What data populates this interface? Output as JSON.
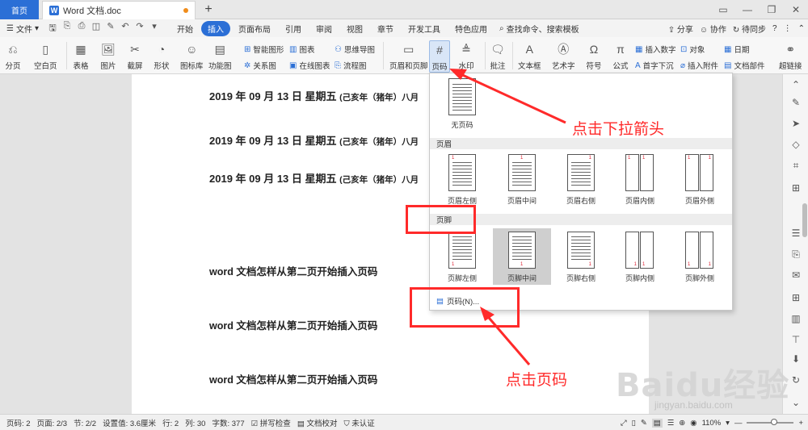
{
  "tabbar": {
    "home": "首页",
    "doc_tab": "Word 文档.doc",
    "new_tab": "+",
    "win_icons": [
      "▭",
      "—",
      "❐",
      "✕"
    ]
  },
  "menubar": {
    "file": "文件",
    "tabs": [
      "开始",
      "插入",
      "页面布局",
      "引用",
      "审阅",
      "视图",
      "章节",
      "开发工具",
      "特色应用"
    ],
    "active_tab": "插入",
    "search": "查找命令、搜索模板",
    "share": "分享",
    "cloud": "协作",
    "pending": "待同步",
    "help": "?"
  },
  "ribbon": {
    "page_break": "分页",
    "blank_page": "空白页",
    "table": "表格",
    "picture": "图片",
    "screenshot": "截屏",
    "shape": "形状",
    "icon_lib": "图标库",
    "func_chart": "功能图",
    "smart_art": "智能图形",
    "chart": "图表",
    "mind_map": "思维导图",
    "relation": "关系图",
    "online_chart": "在线图表",
    "flow_chart": "流程图",
    "header_footer": "页眉和页脚",
    "page_number": "页码",
    "watermark": "水印",
    "comment": "批注",
    "textbox": "文本框",
    "art_text": "艺术字",
    "symbol": "符号",
    "formula": "公式",
    "insert_number": "插入数字",
    "drop_cap": "首字下沉",
    "object": "对象",
    "attachment": "插入附件",
    "date": "日期",
    "doc_parts": "文档部件",
    "hyperlink": "超链接"
  },
  "document": {
    "date_lines": [
      {
        "main": "2019 年 09 月 13 日  星期五",
        "sub": "(己亥年（猪年）八月"
      },
      {
        "main": "2019 年 09 月 13 日  星期五",
        "sub": "(己亥年（猪年）八月"
      },
      {
        "main": "2019 年 09 月 13 日  星期五",
        "sub": "(己亥年（猪年）八月"
      }
    ],
    "title_lines": [
      "word 文档怎样从第二页开始插入页码",
      "word 文档怎样从第二页开始插入页码",
      "word 文档怎样从第二页开始插入页码"
    ]
  },
  "dropdown": {
    "none": "无页码",
    "header_section": "页眉",
    "header_items": [
      "页眉左侧",
      "页眉中间",
      "页眉右侧",
      "页眉内侧",
      "页眉外侧"
    ],
    "footer_section": "页脚",
    "footer_items": [
      "页脚左侧",
      "页脚中间",
      "页脚右侧",
      "页脚内侧",
      "页脚外侧"
    ],
    "page_number_option": "页码(N)..."
  },
  "annotations": {
    "click_arrow": "点击下拉箭头",
    "click_page_number": "点击页码"
  },
  "statusbar": {
    "page_no": "页码: 2",
    "pages": "页面: 2/3",
    "section": "节: 2/2",
    "setting": "设置值: 3.6厘米",
    "row": "行: 2",
    "col": "列: 30",
    "words": "字数: 377",
    "spell": "拼写检查",
    "proof": "文档校对",
    "cert": "未认证",
    "zoom": "110%",
    "zoom_level_pct": 58
  },
  "watermark": {
    "brand": "Baidu经验",
    "url": "jingyan.baidu.com"
  },
  "colors": {
    "accent": "#2b6fd6",
    "annotation": "#ff2a2a"
  }
}
